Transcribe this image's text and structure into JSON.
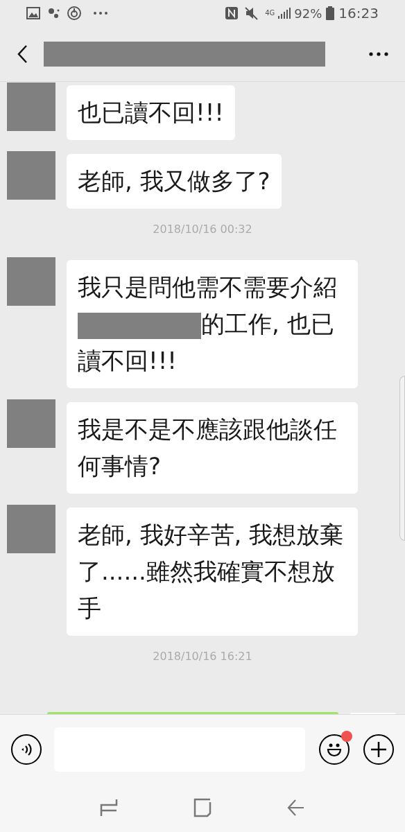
{
  "status_bar": {
    "network": "4G",
    "battery": "92%",
    "time": "16:23"
  },
  "messages": [
    {
      "kind": "message",
      "parts": [
        {
          "kind": "text",
          "text": "也已讀不回!!!"
        }
      ]
    },
    {
      "kind": "message",
      "parts": [
        {
          "kind": "text",
          "text": "老師, 我又做多了?"
        }
      ]
    },
    {
      "kind": "timestamp",
      "text": "2018/10/16 00:32"
    },
    {
      "kind": "message",
      "parts": [
        {
          "kind": "text",
          "text": "我只是問他需不需要介紹"
        },
        {
          "kind": "redacted"
        },
        {
          "kind": "text",
          "text": "的工作, 也已讀不回!!!"
        }
      ]
    },
    {
      "kind": "message",
      "parts": [
        {
          "kind": "text",
          "text": "我是不是不應該跟他談任何事情?"
        }
      ]
    },
    {
      "kind": "message",
      "parts": [
        {
          "kind": "text",
          "text": "老師, 我好辛苦, 我想放棄了......雖然我確實不想放手"
        }
      ]
    },
    {
      "kind": "timestamp",
      "text": "2018/10/16 16:21"
    }
  ],
  "input_bar": {
    "emoji_badge": true
  }
}
